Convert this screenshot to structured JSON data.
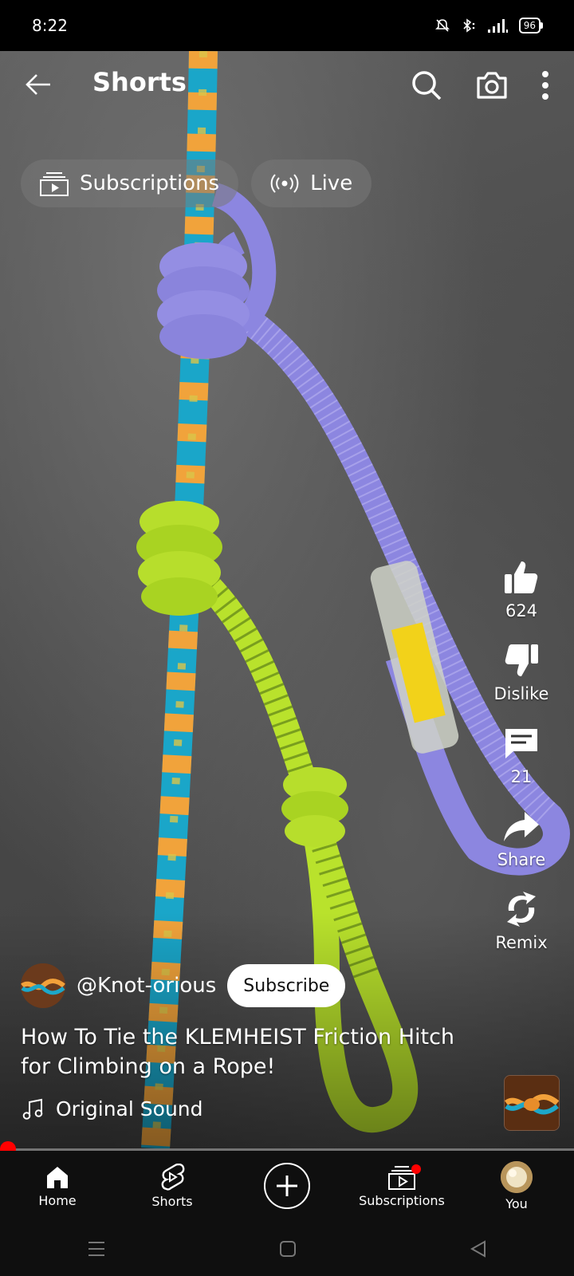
{
  "status_bar": {
    "time": "8:22",
    "battery": "96"
  },
  "top_bar": {
    "title": "Shorts"
  },
  "chips": [
    {
      "label": "Subscriptions",
      "icon": "subscriptions-icon"
    },
    {
      "label": "Live",
      "icon": "live-icon"
    }
  ],
  "actions": {
    "like_count": "624",
    "dislike_label": "Dislike",
    "comment_count": "21",
    "share_label": "Share",
    "remix_label": "Remix"
  },
  "channel": {
    "handle": "@Knot-orious",
    "subscribe_label": "Subscribe"
  },
  "video": {
    "title": "How To Tie the KLEMHEIST Friction Hitch for Climbing on a Rope!"
  },
  "sound": {
    "label": "Original Sound"
  },
  "progress": {
    "fraction": 0.01
  },
  "bottom_nav": [
    {
      "label": "Home",
      "icon": "home-icon"
    },
    {
      "label": "Shorts",
      "icon": "shorts-icon"
    },
    {
      "label": "",
      "icon": "create-icon"
    },
    {
      "label": "Subscriptions",
      "icon": "subscriptions-icon"
    },
    {
      "label": "You",
      "icon": "avatar"
    }
  ],
  "colors": {
    "accent": "#ff0000",
    "nav_bg": "#0f0f0f"
  }
}
